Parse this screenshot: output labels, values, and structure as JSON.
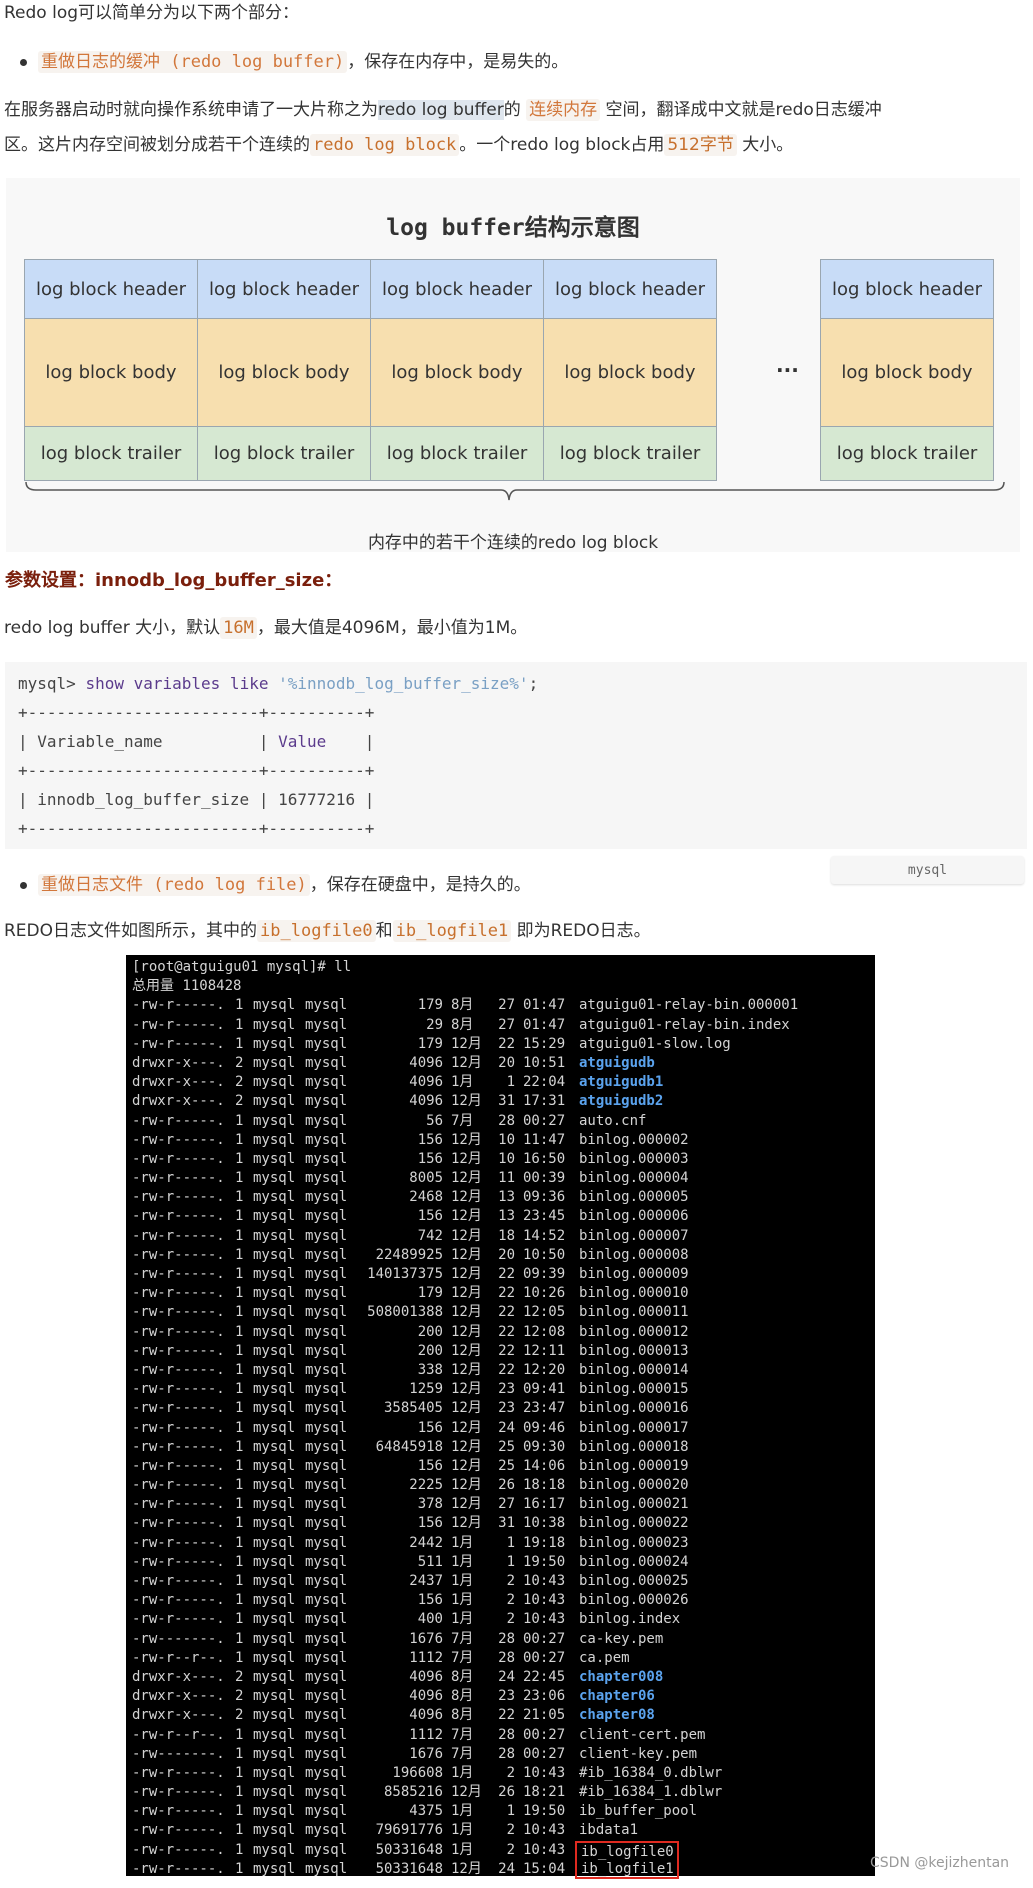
{
  "intro": "Redo log可以简单分为以下两个部分：",
  "bullet1": {
    "code": "重做日志的缓冲 (redo log buffer)",
    "rest": "，保存在内存中，是易失的。"
  },
  "para1": {
    "line1_a": "在服务器启动时就向操作系统申请了一大片称之为",
    "line1_hl": "redo log buffer",
    "line1_b": "的",
    "line1_code": "连续内存",
    "line1_c": "空间，翻译成中文就是redo日志缓冲",
    "line2_a": "区。这片内存空间被划分成若干个连续的",
    "line2_code": "redo log block",
    "line2_b": "。一个redo log block占用",
    "line2_code2": "512字节",
    "line2_c": "大小。"
  },
  "diagram": {
    "title": "log buffer结构示意图",
    "header": "log block header",
    "body": "log block body",
    "trailer": "log block trailer",
    "ellipsis": "···",
    "caption": "内存中的若干个连续的redo log block",
    "colors": {
      "header": "#c8dcf7",
      "body": "#f7dfaf",
      "trailer": "#d6e8d2"
    }
  },
  "heading": "参数设置：innodb_log_buffer_size：",
  "para2": {
    "a": "redo log buffer 大小，默认",
    "code": "16M",
    "b": "，最大值是4096M，最小值为1M。"
  },
  "codeblock": {
    "prompt": "mysql> ",
    "kw": "show variables like",
    "str": "'%innodb_log_buffer_size%'",
    "end": ";",
    "sep": "+------------------------+----------+",
    "hdr_a": "| Variable_name          | ",
    "hdr_kw": "Value",
    "hdr_b": "    |",
    "row": "| innodb_log_buffer_size | 16777216 |",
    "lang": "mysql"
  },
  "bullet2": {
    "code": "重做日志文件 (redo log file)",
    "rest": "，保存在硬盘中，是持久的。"
  },
  "para3": {
    "a": "REDO日志文件如图所示，其中的",
    "code1": "ib_logfile0",
    "b": "和",
    "code2": "ib_logfile1",
    "c": "即为REDO日志。"
  },
  "terminal": {
    "prompt": "[root@atguigu01 mysql]# ll",
    "total": "总用量 1108428",
    "dir_color": "#5ba3ee",
    "highlight_color": "#e02a20",
    "rows": [
      [
        "-rw-r-----.",
        "1",
        "mysql",
        "mysql",
        "179",
        "8月",
        "27",
        "01:47",
        "atguigu01-relay-bin.000001",
        "file"
      ],
      [
        "-rw-r-----.",
        "1",
        "mysql",
        "mysql",
        "29",
        "8月",
        "27",
        "01:47",
        "atguigu01-relay-bin.index",
        "file"
      ],
      [
        "-rw-r-----.",
        "1",
        "mysql",
        "mysql",
        "179",
        "12月",
        "22",
        "15:29",
        "atguigu01-slow.log",
        "file"
      ],
      [
        "drwxr-x---.",
        "2",
        "mysql",
        "mysql",
        "4096",
        "12月",
        "20",
        "10:51",
        "atguigudb",
        "dir"
      ],
      [
        "drwxr-x---.",
        "2",
        "mysql",
        "mysql",
        "4096",
        "1月",
        "1",
        "22:04",
        "atguigudb1",
        "dir"
      ],
      [
        "drwxr-x---.",
        "2",
        "mysql",
        "mysql",
        "4096",
        "12月",
        "31",
        "17:31",
        "atguigudb2",
        "dir"
      ],
      [
        "-rw-r-----.",
        "1",
        "mysql",
        "mysql",
        "56",
        "7月",
        "28",
        "00:27",
        "auto.cnf",
        "file"
      ],
      [
        "-rw-r-----.",
        "1",
        "mysql",
        "mysql",
        "156",
        "12月",
        "10",
        "11:47",
        "binlog.000002",
        "file"
      ],
      [
        "-rw-r-----.",
        "1",
        "mysql",
        "mysql",
        "156",
        "12月",
        "10",
        "16:50",
        "binlog.000003",
        "file"
      ],
      [
        "-rw-r-----.",
        "1",
        "mysql",
        "mysql",
        "8005",
        "12月",
        "11",
        "00:39",
        "binlog.000004",
        "file"
      ],
      [
        "-rw-r-----.",
        "1",
        "mysql",
        "mysql",
        "2468",
        "12月",
        "13",
        "09:36",
        "binlog.000005",
        "file"
      ],
      [
        "-rw-r-----.",
        "1",
        "mysql",
        "mysql",
        "156",
        "12月",
        "13",
        "23:45",
        "binlog.000006",
        "file"
      ],
      [
        "-rw-r-----.",
        "1",
        "mysql",
        "mysql",
        "742",
        "12月",
        "18",
        "14:52",
        "binlog.000007",
        "file"
      ],
      [
        "-rw-r-----.",
        "1",
        "mysql",
        "mysql",
        "22489925",
        "12月",
        "20",
        "10:50",
        "binlog.000008",
        "file"
      ],
      [
        "-rw-r-----.",
        "1",
        "mysql",
        "mysql",
        "140137375",
        "12月",
        "22",
        "09:39",
        "binlog.000009",
        "file"
      ],
      [
        "-rw-r-----.",
        "1",
        "mysql",
        "mysql",
        "179",
        "12月",
        "22",
        "10:26",
        "binlog.000010",
        "file"
      ],
      [
        "-rw-r-----.",
        "1",
        "mysql",
        "mysql",
        "508001388",
        "12月",
        "22",
        "12:05",
        "binlog.000011",
        "file"
      ],
      [
        "-rw-r-----.",
        "1",
        "mysql",
        "mysql",
        "200",
        "12月",
        "22",
        "12:08",
        "binlog.000012",
        "file"
      ],
      [
        "-rw-r-----.",
        "1",
        "mysql",
        "mysql",
        "200",
        "12月",
        "22",
        "12:11",
        "binlog.000013",
        "file"
      ],
      [
        "-rw-r-----.",
        "1",
        "mysql",
        "mysql",
        "338",
        "12月",
        "22",
        "12:20",
        "binlog.000014",
        "file"
      ],
      [
        "-rw-r-----.",
        "1",
        "mysql",
        "mysql",
        "1259",
        "12月",
        "23",
        "09:41",
        "binlog.000015",
        "file"
      ],
      [
        "-rw-r-----.",
        "1",
        "mysql",
        "mysql",
        "3585405",
        "12月",
        "23",
        "23:47",
        "binlog.000016",
        "file"
      ],
      [
        "-rw-r-----.",
        "1",
        "mysql",
        "mysql",
        "156",
        "12月",
        "24",
        "09:46",
        "binlog.000017",
        "file"
      ],
      [
        "-rw-r-----.",
        "1",
        "mysql",
        "mysql",
        "64845918",
        "12月",
        "25",
        "09:30",
        "binlog.000018",
        "file"
      ],
      [
        "-rw-r-----.",
        "1",
        "mysql",
        "mysql",
        "156",
        "12月",
        "25",
        "14:06",
        "binlog.000019",
        "file"
      ],
      [
        "-rw-r-----.",
        "1",
        "mysql",
        "mysql",
        "2225",
        "12月",
        "26",
        "18:18",
        "binlog.000020",
        "file"
      ],
      [
        "-rw-r-----.",
        "1",
        "mysql",
        "mysql",
        "378",
        "12月",
        "27",
        "16:17",
        "binlog.000021",
        "file"
      ],
      [
        "-rw-r-----.",
        "1",
        "mysql",
        "mysql",
        "156",
        "12月",
        "31",
        "10:38",
        "binlog.000022",
        "file"
      ],
      [
        "-rw-r-----.",
        "1",
        "mysql",
        "mysql",
        "2442",
        "1月",
        "1",
        "19:18",
        "binlog.000023",
        "file"
      ],
      [
        "-rw-r-----.",
        "1",
        "mysql",
        "mysql",
        "511",
        "1月",
        "1",
        "19:50",
        "binlog.000024",
        "file"
      ],
      [
        "-rw-r-----.",
        "1",
        "mysql",
        "mysql",
        "2437",
        "1月",
        "2",
        "10:43",
        "binlog.000025",
        "file"
      ],
      [
        "-rw-r-----.",
        "1",
        "mysql",
        "mysql",
        "156",
        "1月",
        "2",
        "10:43",
        "binlog.000026",
        "file"
      ],
      [
        "-rw-r-----.",
        "1",
        "mysql",
        "mysql",
        "400",
        "1月",
        "2",
        "10:43",
        "binlog.index",
        "file"
      ],
      [
        "-rw-------.",
        "1",
        "mysql",
        "mysql",
        "1676",
        "7月",
        "28",
        "00:27",
        "ca-key.pem",
        "file"
      ],
      [
        "-rw-r--r--.",
        "1",
        "mysql",
        "mysql",
        "1112",
        "7月",
        "28",
        "00:27",
        "ca.pem",
        "file"
      ],
      [
        "drwxr-x---.",
        "2",
        "mysql",
        "mysql",
        "4096",
        "8月",
        "24",
        "22:45",
        "chapter008",
        "dir"
      ],
      [
        "drwxr-x---.",
        "2",
        "mysql",
        "mysql",
        "4096",
        "8月",
        "23",
        "23:06",
        "chapter06",
        "dir"
      ],
      [
        "drwxr-x---.",
        "2",
        "mysql",
        "mysql",
        "4096",
        "8月",
        "22",
        "21:05",
        "chapter08",
        "dir"
      ],
      [
        "-rw-r--r--.",
        "1",
        "mysql",
        "mysql",
        "1112",
        "7月",
        "28",
        "00:27",
        "client-cert.pem",
        "file"
      ],
      [
        "-rw-------.",
        "1",
        "mysql",
        "mysql",
        "1676",
        "7月",
        "28",
        "00:27",
        "client-key.pem",
        "file"
      ],
      [
        "-rw-r-----.",
        "1",
        "mysql",
        "mysql",
        "196608",
        "1月",
        "2",
        "10:43",
        "#ib_16384_0.dblwr",
        "file"
      ],
      [
        "-rw-r-----.",
        "1",
        "mysql",
        "mysql",
        "8585216",
        "12月",
        "26",
        "18:21",
        "#ib_16384_1.dblwr",
        "file"
      ],
      [
        "-rw-r-----.",
        "1",
        "mysql",
        "mysql",
        "4375",
        "1月",
        "1",
        "19:50",
        "ib_buffer_pool",
        "file"
      ],
      [
        "-rw-r-----.",
        "1",
        "mysql",
        "mysql",
        "79691776",
        "1月",
        "2",
        "10:43",
        "ibdata1",
        "file"
      ],
      [
        "-rw-r-----.",
        "1",
        "mysql",
        "mysql",
        "50331648",
        "1月",
        "2",
        "10:43",
        "ib_logfile0",
        "highlight-top"
      ],
      [
        "-rw-r-----.",
        "1",
        "mysql",
        "mysql",
        "50331648",
        "12月",
        "24",
        "15:04",
        "ib_logfile1",
        "highlight-bottom"
      ]
    ]
  },
  "watermark": "CSDN @kejizhentan"
}
